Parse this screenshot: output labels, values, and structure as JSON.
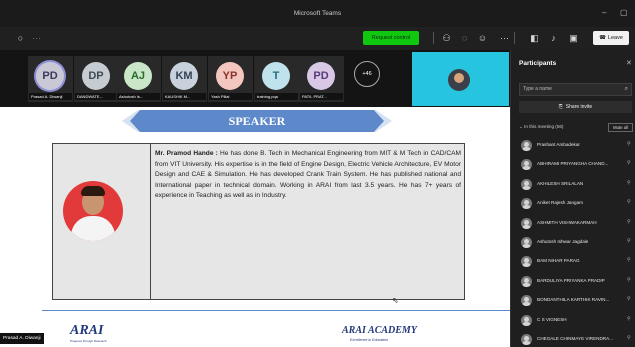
{
  "window": {
    "title": "Microsoft Teams"
  },
  "toolbar": {
    "request_control": "Request control",
    "leave": "Leave"
  },
  "gallery": {
    "tiles": [
      {
        "initials": "PD",
        "name": "Prasad A. Diwanji",
        "bg": "#c9c9d6",
        "fg": "#3a3a5a",
        "ring": true
      },
      {
        "initials": "DP",
        "name": "DANDWATE...",
        "bg": "#c6ccd2",
        "fg": "#3f4a55"
      },
      {
        "initials": "AJ",
        "name": "Ashutosh Is...",
        "bg": "#c9e6c9",
        "fg": "#2a6a2a"
      },
      {
        "initials": "KM",
        "name": "KAUSHIK M...",
        "bg": "#c9d2dc",
        "fg": "#324252"
      },
      {
        "initials": "YP",
        "name": "Yash Pillai",
        "bg": "#f4c6c0",
        "fg": "#8a3228"
      },
      {
        "initials": "T",
        "name": "training.pqa",
        "bg": "#bfe2ec",
        "fg": "#2a6a7a"
      },
      {
        "initials": "PD",
        "name": "PATIL PRAT...",
        "bg": "#d8c8e6",
        "fg": "#5a3a7a"
      }
    ],
    "more": "+46"
  },
  "slide": {
    "banner": "SPEAKER",
    "bio_name": "Mr. Pramod Hande :",
    "bio_text": " He has done B. Tech in Mechanical Engineering from MIT & M Tech in CAD/CAM from VIT University. His expertise is in the field of Engine Design, Electric Vehicle Architecture, EV Motor Design and CAE & Simulation. He has developed Crank Train System. He has published national and International paper in technical domain. Working in ARAI from last 3.5 years. He has 7+ years of experience in Teaching as well as in Industry.",
    "arai_logo": "ARAI",
    "arai_tag": "Progress through Research",
    "academy_logo": "ARAI ACADEMY",
    "academy_tag": "Excellence in Education"
  },
  "presenter": "Prasad A. Diwanji",
  "participants": {
    "title": "Participants",
    "search_placeholder": "Type a name",
    "share_invite": "Share invite",
    "section": "In this meeting (56)",
    "mute_all": "Mute all",
    "list": [
      "Prashant Ambadekar",
      "ABHIRAMI PRIYANGHA CHAND...",
      "AKHILESH SRILALAN",
      "Aniket Rajesh Jangam",
      "ASHMITH VISHWAKARMAH",
      "Ashutosh Ishwar Jagdale",
      "BAM NIHAR PARAG",
      "BARDULIYA PRIYANKA PRADIP",
      "BONDANTHILA KARTHIK RAVIN...",
      "C S VIGNESH",
      "CHEGALE CHINMAYE VIRENDRA..."
    ]
  }
}
